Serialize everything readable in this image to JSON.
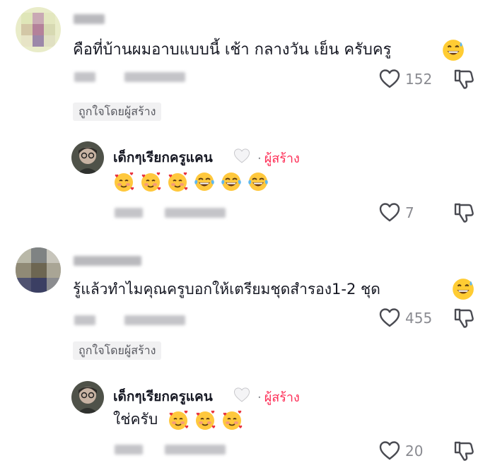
{
  "comments": [
    {
      "text": "คือที่บ้านผมอาบแบบนี้ เช้า กลางวัน เย็น ครับครู",
      "likes": "152",
      "liked_by_creator": "ถูกใจโดยผู้สร้าง",
      "reply": {
        "author": "เด็กๆเรียกครูแคน",
        "creator_label": "ผู้สร้าง",
        "likes": "7",
        "emojis": [
          "smiling-face-hearts",
          "smiling-face-hearts",
          "smiling-face-hearts",
          "tears-of-joy",
          "tears-of-joy",
          "tears-of-joy"
        ]
      }
    },
    {
      "text": "รู้แล้วทำไมคุณครูบอกให้เตรียมชุดสำรอง1-2 ชุด",
      "likes": "455",
      "liked_by_creator": "ถูกใจโดยผู้สร้าง",
      "reply": {
        "author": "เด็กๆเรียกครูแคน",
        "creator_label": "ผู้สร้าง",
        "text": "ใช่ครับ",
        "likes": "20",
        "emojis": [
          "smiling-face-hearts",
          "smiling-face-hearts",
          "smiling-face-hearts"
        ]
      }
    }
  ],
  "colors": {
    "creator": "#fe2c55",
    "muted": "#8a8b91",
    "badge_bg": "#f1f1f2"
  }
}
